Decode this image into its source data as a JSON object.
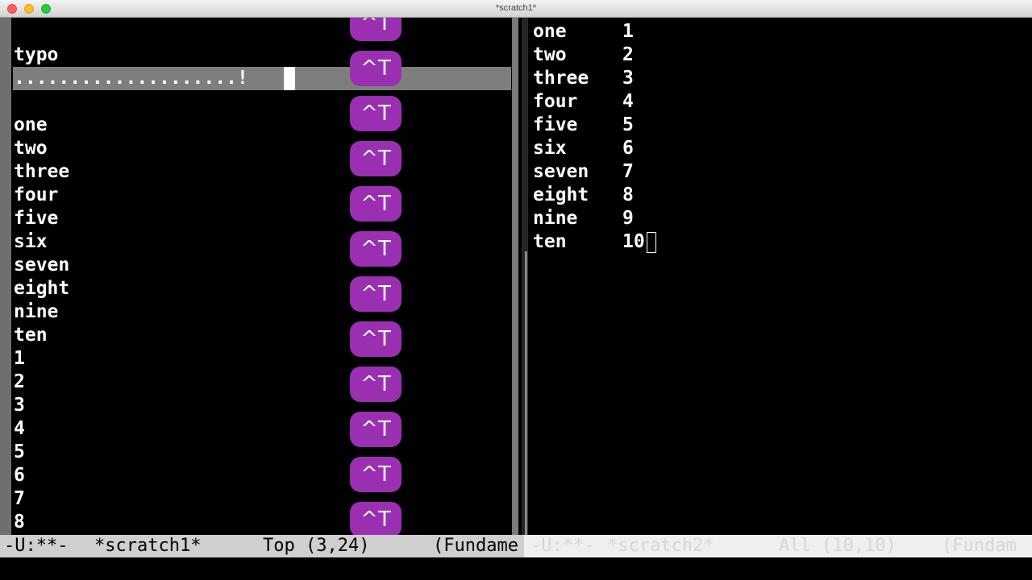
{
  "window": {
    "title": "*scratch1*"
  },
  "left_buffer": {
    "lines": [
      "",
      "typo",
      "....................!",
      "",
      "one",
      "two",
      "three",
      "four",
      "five",
      "six",
      "seven",
      "eight",
      "nine",
      "ten",
      "1",
      "2",
      "3",
      "4",
      "5",
      "6",
      "7",
      "8"
    ],
    "highlighted_line_index": 2
  },
  "right_buffer": {
    "rows": [
      {
        "word": "one",
        "num": "1"
      },
      {
        "word": "two",
        "num": "2"
      },
      {
        "word": "three",
        "num": "3"
      },
      {
        "word": "four",
        "num": "4"
      },
      {
        "word": "five",
        "num": "5"
      },
      {
        "word": "six",
        "num": "6"
      },
      {
        "word": "seven",
        "num": "7"
      },
      {
        "word": "eight",
        "num": "8"
      },
      {
        "word": "nine",
        "num": "9"
      },
      {
        "word": "ten",
        "num": "10"
      }
    ]
  },
  "keystrokes": [
    "^T",
    "^T",
    "^T",
    "^T",
    "^T",
    "^T",
    "^T",
    "^T",
    "^T",
    "^T",
    "^T",
    "^T"
  ],
  "modeline_left": {
    "status": "-U:**-",
    "buffer": "*scratch1*",
    "position": "Top (3,24)",
    "mode": "(Fundame"
  },
  "modeline_right": {
    "status": "-U:**-",
    "buffer": "*scratch2*",
    "position": "All (10,10)",
    "mode": "(Fundam"
  },
  "colors": {
    "keystroke_badge": "#9a2fb1",
    "region_highlight": "#7e7e7e",
    "active_modeline": "#cfcfcf",
    "inactive_modeline": "#efefef"
  }
}
